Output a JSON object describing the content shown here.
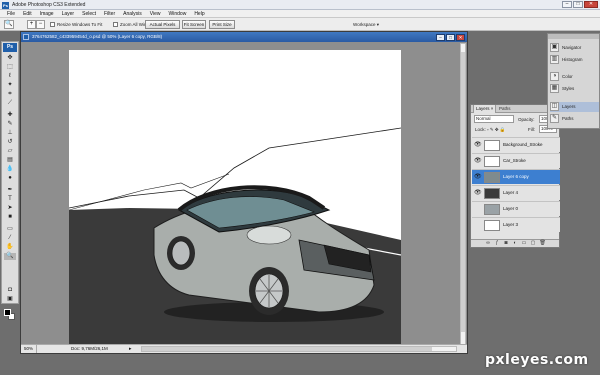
{
  "window": {
    "title": "Adobe Photoshop CS3 Extended",
    "app_icon": "Ps"
  },
  "menu": [
    "File",
    "Edit",
    "Image",
    "Layer",
    "Select",
    "Filter",
    "Analysis",
    "View",
    "Window",
    "Help"
  ],
  "options_bar": {
    "resize_windows_label": "Resize Windows To Fit",
    "zoom_all_label": "Zoom All Windows",
    "actual_pixels": "Actual Pixels",
    "fit_screen": "Fit Screen",
    "print_size": "Print Size",
    "workspace": "Workspace ▾"
  },
  "toolbox": {
    "badge": "Ps"
  },
  "document": {
    "title": "3764762582_c433959454d_o.psd @ 50% (Layer 6 copy, RGB/8)",
    "zoom": "50%",
    "doc_info": "Doc: 9,76M/26,1M"
  },
  "layers_panel": {
    "tabs": [
      "Layers ×",
      "Paths"
    ],
    "blend_mode": "Normal",
    "opacity_label": "Opacity:",
    "opacity": "100%",
    "lock_label": "Lock:",
    "fill_label": "Fill:",
    "fill": "100%",
    "layers": [
      {
        "name": "Background_Stroke",
        "visible": true
      },
      {
        "name": "Car_Stroke",
        "visible": true
      },
      {
        "name": "Layer 6 copy",
        "visible": true,
        "active": true
      },
      {
        "name": "Layer 4",
        "visible": true
      },
      {
        "name": "Layer 0",
        "visible": false
      },
      {
        "name": "Layer 3",
        "visible": false
      }
    ]
  },
  "dock": [
    "Navigator",
    "Histogram",
    "Color",
    "Styles",
    "Layers",
    "Paths"
  ],
  "watermark": "pxleyes.com",
  "colors": {
    "road": "#3a3a3a",
    "sky": "#ffffff",
    "car_body": "#a9aeab",
    "car_roof": "#2a2b2d",
    "selected_layer": "#3d7fd0"
  }
}
